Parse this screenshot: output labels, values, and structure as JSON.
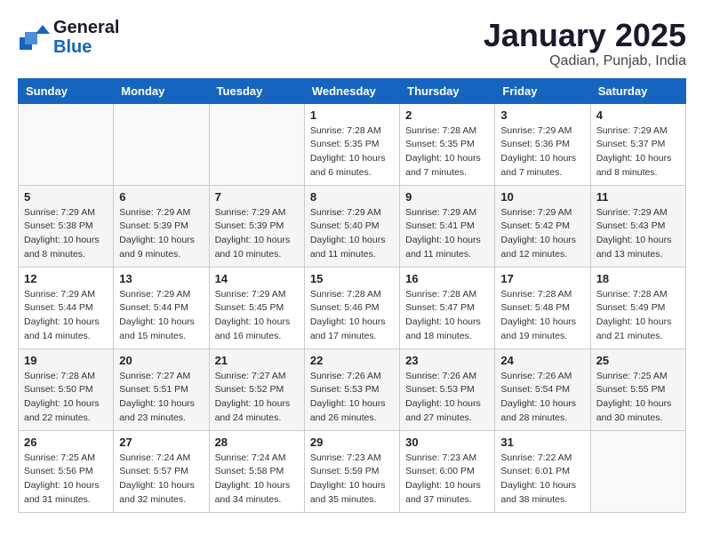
{
  "header": {
    "logo_line1": "General",
    "logo_line2": "Blue",
    "month": "January 2025",
    "location": "Qadian, Punjab, India"
  },
  "days_of_week": [
    "Sunday",
    "Monday",
    "Tuesday",
    "Wednesday",
    "Thursday",
    "Friday",
    "Saturday"
  ],
  "weeks": [
    [
      {
        "day": "",
        "info": ""
      },
      {
        "day": "",
        "info": ""
      },
      {
        "day": "",
        "info": ""
      },
      {
        "day": "1",
        "info": "Sunrise: 7:28 AM\nSunset: 5:35 PM\nDaylight: 10 hours\nand 6 minutes."
      },
      {
        "day": "2",
        "info": "Sunrise: 7:28 AM\nSunset: 5:35 PM\nDaylight: 10 hours\nand 7 minutes."
      },
      {
        "day": "3",
        "info": "Sunrise: 7:29 AM\nSunset: 5:36 PM\nDaylight: 10 hours\nand 7 minutes."
      },
      {
        "day": "4",
        "info": "Sunrise: 7:29 AM\nSunset: 5:37 PM\nDaylight: 10 hours\nand 8 minutes."
      }
    ],
    [
      {
        "day": "5",
        "info": "Sunrise: 7:29 AM\nSunset: 5:38 PM\nDaylight: 10 hours\nand 8 minutes."
      },
      {
        "day": "6",
        "info": "Sunrise: 7:29 AM\nSunset: 5:39 PM\nDaylight: 10 hours\nand 9 minutes."
      },
      {
        "day": "7",
        "info": "Sunrise: 7:29 AM\nSunset: 5:39 PM\nDaylight: 10 hours\nand 10 minutes."
      },
      {
        "day": "8",
        "info": "Sunrise: 7:29 AM\nSunset: 5:40 PM\nDaylight: 10 hours\nand 11 minutes."
      },
      {
        "day": "9",
        "info": "Sunrise: 7:29 AM\nSunset: 5:41 PM\nDaylight: 10 hours\nand 11 minutes."
      },
      {
        "day": "10",
        "info": "Sunrise: 7:29 AM\nSunset: 5:42 PM\nDaylight: 10 hours\nand 12 minutes."
      },
      {
        "day": "11",
        "info": "Sunrise: 7:29 AM\nSunset: 5:43 PM\nDaylight: 10 hours\nand 13 minutes."
      }
    ],
    [
      {
        "day": "12",
        "info": "Sunrise: 7:29 AM\nSunset: 5:44 PM\nDaylight: 10 hours\nand 14 minutes."
      },
      {
        "day": "13",
        "info": "Sunrise: 7:29 AM\nSunset: 5:44 PM\nDaylight: 10 hours\nand 15 minutes."
      },
      {
        "day": "14",
        "info": "Sunrise: 7:29 AM\nSunset: 5:45 PM\nDaylight: 10 hours\nand 16 minutes."
      },
      {
        "day": "15",
        "info": "Sunrise: 7:28 AM\nSunset: 5:46 PM\nDaylight: 10 hours\nand 17 minutes."
      },
      {
        "day": "16",
        "info": "Sunrise: 7:28 AM\nSunset: 5:47 PM\nDaylight: 10 hours\nand 18 minutes."
      },
      {
        "day": "17",
        "info": "Sunrise: 7:28 AM\nSunset: 5:48 PM\nDaylight: 10 hours\nand 19 minutes."
      },
      {
        "day": "18",
        "info": "Sunrise: 7:28 AM\nSunset: 5:49 PM\nDaylight: 10 hours\nand 21 minutes."
      }
    ],
    [
      {
        "day": "19",
        "info": "Sunrise: 7:28 AM\nSunset: 5:50 PM\nDaylight: 10 hours\nand 22 minutes."
      },
      {
        "day": "20",
        "info": "Sunrise: 7:27 AM\nSunset: 5:51 PM\nDaylight: 10 hours\nand 23 minutes."
      },
      {
        "day": "21",
        "info": "Sunrise: 7:27 AM\nSunset: 5:52 PM\nDaylight: 10 hours\nand 24 minutes."
      },
      {
        "day": "22",
        "info": "Sunrise: 7:26 AM\nSunset: 5:53 PM\nDaylight: 10 hours\nand 26 minutes."
      },
      {
        "day": "23",
        "info": "Sunrise: 7:26 AM\nSunset: 5:53 PM\nDaylight: 10 hours\nand 27 minutes."
      },
      {
        "day": "24",
        "info": "Sunrise: 7:26 AM\nSunset: 5:54 PM\nDaylight: 10 hours\nand 28 minutes."
      },
      {
        "day": "25",
        "info": "Sunrise: 7:25 AM\nSunset: 5:55 PM\nDaylight: 10 hours\nand 30 minutes."
      }
    ],
    [
      {
        "day": "26",
        "info": "Sunrise: 7:25 AM\nSunset: 5:56 PM\nDaylight: 10 hours\nand 31 minutes."
      },
      {
        "day": "27",
        "info": "Sunrise: 7:24 AM\nSunset: 5:57 PM\nDaylight: 10 hours\nand 32 minutes."
      },
      {
        "day": "28",
        "info": "Sunrise: 7:24 AM\nSunset: 5:58 PM\nDaylight: 10 hours\nand 34 minutes."
      },
      {
        "day": "29",
        "info": "Sunrise: 7:23 AM\nSunset: 5:59 PM\nDaylight: 10 hours\nand 35 minutes."
      },
      {
        "day": "30",
        "info": "Sunrise: 7:23 AM\nSunset: 6:00 PM\nDaylight: 10 hours\nand 37 minutes."
      },
      {
        "day": "31",
        "info": "Sunrise: 7:22 AM\nSunset: 6:01 PM\nDaylight: 10 hours\nand 38 minutes."
      },
      {
        "day": "",
        "info": ""
      }
    ]
  ]
}
